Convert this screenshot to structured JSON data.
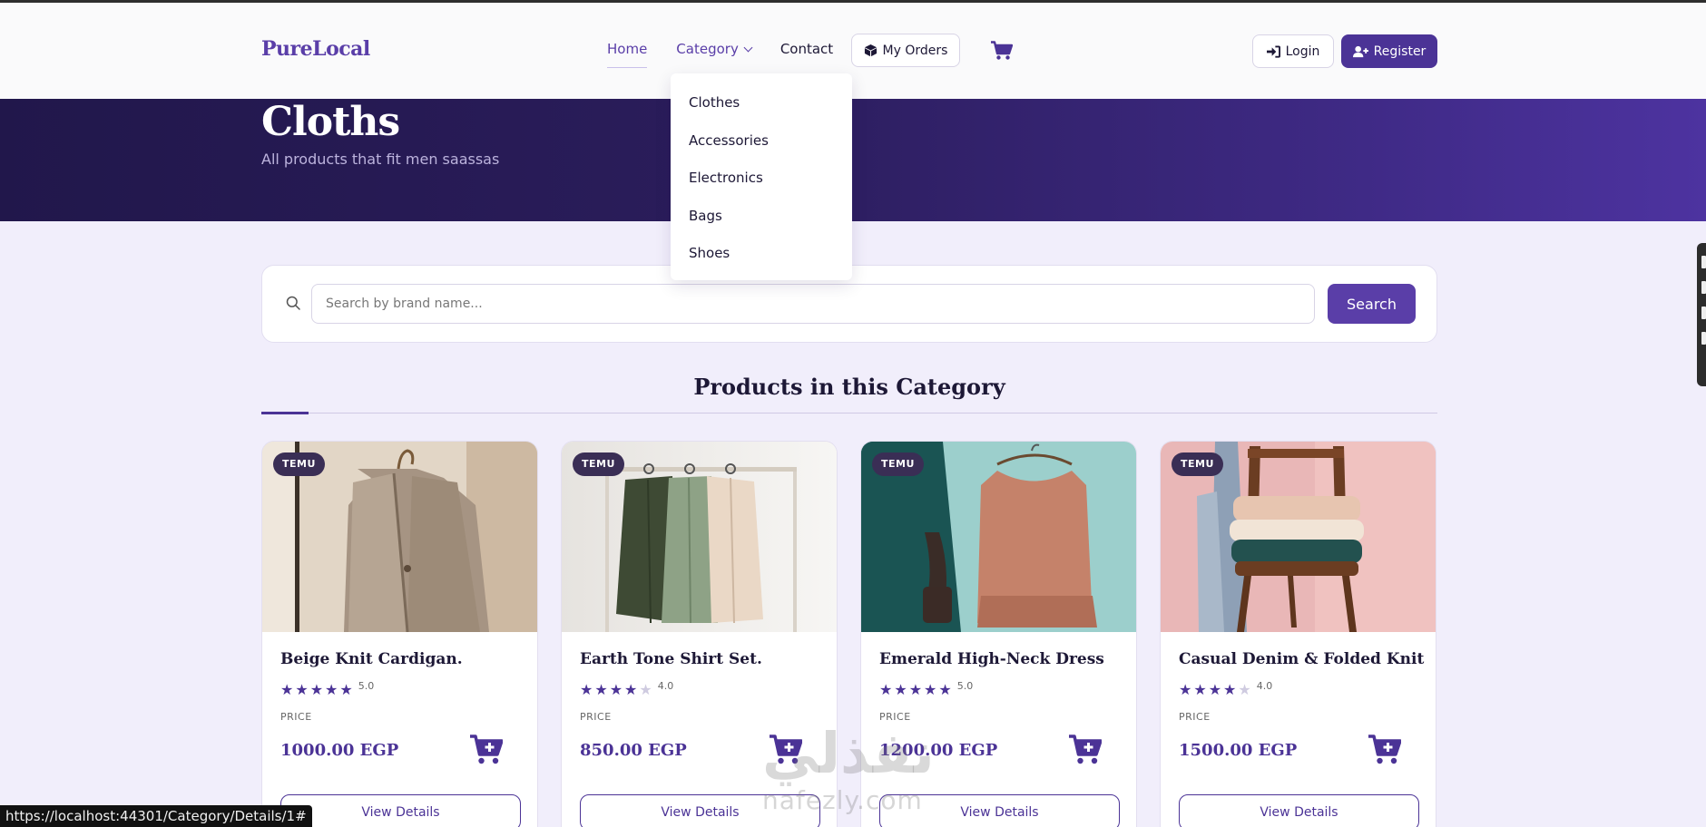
{
  "brand": "PureLocal",
  "nav": {
    "home": "Home",
    "category": "Category",
    "contact": "Contact",
    "my_orders": "My Orders",
    "login": "Login",
    "register": "Register"
  },
  "category_menu": [
    "Clothes",
    "Accessories",
    "Electronics",
    "Bags",
    "Shoes"
  ],
  "hero": {
    "title": "Cloths",
    "subtitle": "All products that fit men saassas"
  },
  "search": {
    "placeholder": "Search by brand name...",
    "button": "Search"
  },
  "section_title": "Products in this Category",
  "products": [
    {
      "badge": "TEMU",
      "name": "Beige Knit Cardigan.",
      "rating": 5,
      "rating_label": "5.0",
      "price_label": "PRICE",
      "price": "1000.00 EGP",
      "details": "View Details"
    },
    {
      "badge": "TEMU",
      "name": "Earth Tone Shirt Set.",
      "rating": 4,
      "rating_label": "4.0",
      "price_label": "PRICE",
      "price": "850.00 EGP",
      "details": "View Details"
    },
    {
      "badge": "TEMU",
      "name": "Emerald High-Neck Dress",
      "rating": 5,
      "rating_label": "5.0",
      "price_label": "PRICE",
      "price": "1200.00 EGP",
      "details": "View Details"
    },
    {
      "badge": "TEMU",
      "name": "Casual Denim & Folded Knit",
      "rating": 4,
      "rating_label": "4.0",
      "price_label": "PRICE",
      "price": "1500.00 EGP",
      "details": "View Details"
    }
  ],
  "status_url": "https://localhost:44301/Category/Details/1#",
  "watermark": {
    "logo": "نفذلي",
    "text": "nafezly.com"
  },
  "colors": {
    "accent": "#4b3396",
    "hero_dark": "#21174b",
    "hero_light": "#4d33a0",
    "background": "#f1eefb"
  },
  "icons": {
    "orders": "box-icon",
    "cart": "cart-icon",
    "login": "sign-in-icon",
    "register": "user-plus-icon",
    "search": "search-icon",
    "add_to_cart": "cart-plus-icon",
    "star": "star-icon"
  }
}
